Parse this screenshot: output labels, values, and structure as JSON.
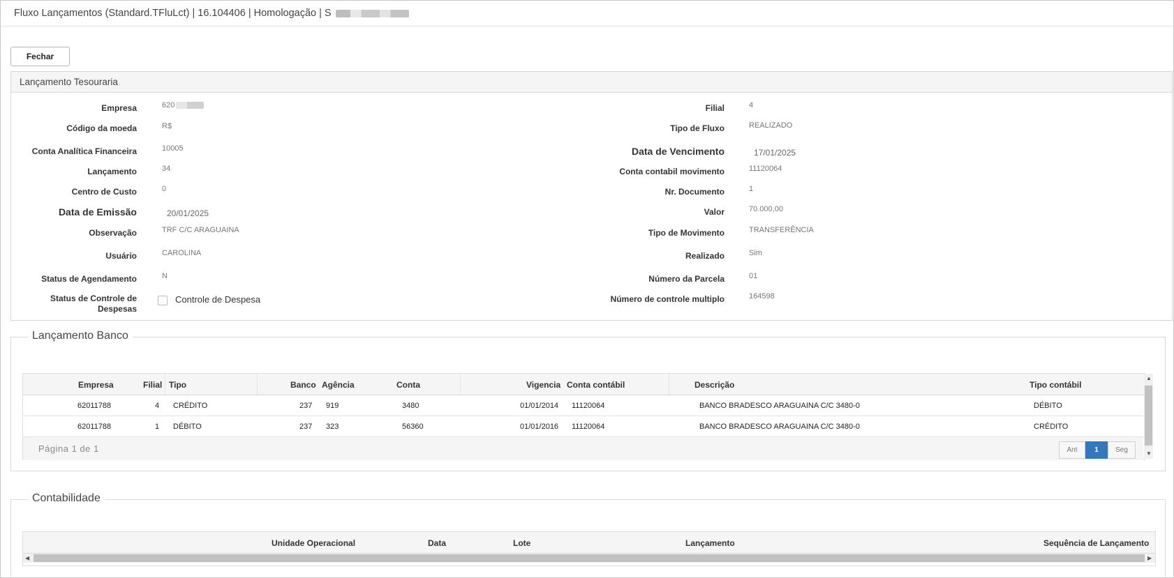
{
  "window": {
    "title": "Fluxo Lançamentos (Standard.TFluLct) | 16.104406 | Homologação | S"
  },
  "toolbar": {
    "close_label": "Fechar"
  },
  "tesouraria": {
    "title": "Lançamento Tesouraria",
    "left": {
      "empresa_label": "Empresa",
      "empresa_value": "620",
      "moeda_label": "Código da moeda",
      "moeda_value": "R$",
      "conta_label": "Conta Analítica Financeira",
      "conta_value": "10005",
      "lanc_label": "Lançamento",
      "lanc_value": "34",
      "centro_label": "Centro de Custo",
      "centro_value": "0",
      "emissao_label": "Data de Emissão",
      "emissao_value": "20/01/2025",
      "obs_label": "Observação",
      "obs_value": "TRF C/C ARAGUAINA",
      "usuario_label": "Usuário",
      "usuario_value": "CAROLINA",
      "agend_label": "Status de Agendamento",
      "agend_value": "N",
      "controle_label": "Status de Controle de Despesas",
      "controle_check_label": "Controle de Despesa"
    },
    "right": {
      "filial_label": "Filial",
      "filial_value": "4",
      "tipofluxo_label": "Tipo de Fluxo",
      "tipofluxo_value": "REALIZADO",
      "venc_label": "Data de Vencimento",
      "venc_value": "17/01/2025",
      "contamov_label": "Conta contabil movimento",
      "contamov_value": "11120064",
      "nrdoc_label": "Nr. Documento",
      "nrdoc_value": "1",
      "valor_label": "Valor",
      "valor_value": "70.000,00",
      "tipomov_label": "Tipo de Movimento",
      "tipomov_value": "TRANSFERÊNCIA",
      "realizado_label": "Realizado",
      "realizado_value": "Sim",
      "parcela_label": "Número da Parcela",
      "parcela_value": "01",
      "multiplo_label": "Número de controle multiplo",
      "multiplo_value": "164598"
    }
  },
  "banco": {
    "title": "Lançamento Banco",
    "columns": [
      "Empresa",
      "Filial",
      "Tipo",
      "Banco",
      "Agência",
      "Conta",
      "Vigencia",
      "Conta contábil",
      "Descrição",
      "Tipo contábil"
    ],
    "rows": [
      [
        "62011788",
        "4",
        "CRÉDITO",
        "237",
        "919",
        "3480",
        "01/01/2014",
        "11120064",
        "BANCO BRADESCO ARAGUAINA C/C 3480-0",
        "DÉBITO"
      ],
      [
        "62011788",
        "1",
        "DÉBITO",
        "237",
        "323",
        "56360",
        "01/01/2016",
        "11120064",
        "BANCO BRADESCO ARAGUAINA C/C 3480-0",
        "CRÉDITO"
      ]
    ],
    "pager": {
      "text": "Página 1 de 1",
      "prev": "Ant",
      "current": "1",
      "next": "Seg"
    }
  },
  "contabilidade": {
    "title": "Contabilidade",
    "columns": [
      "Unidade Operacional",
      "Data",
      "Lote",
      "Lançamento",
      "Sequência de Lançamento"
    ]
  }
}
